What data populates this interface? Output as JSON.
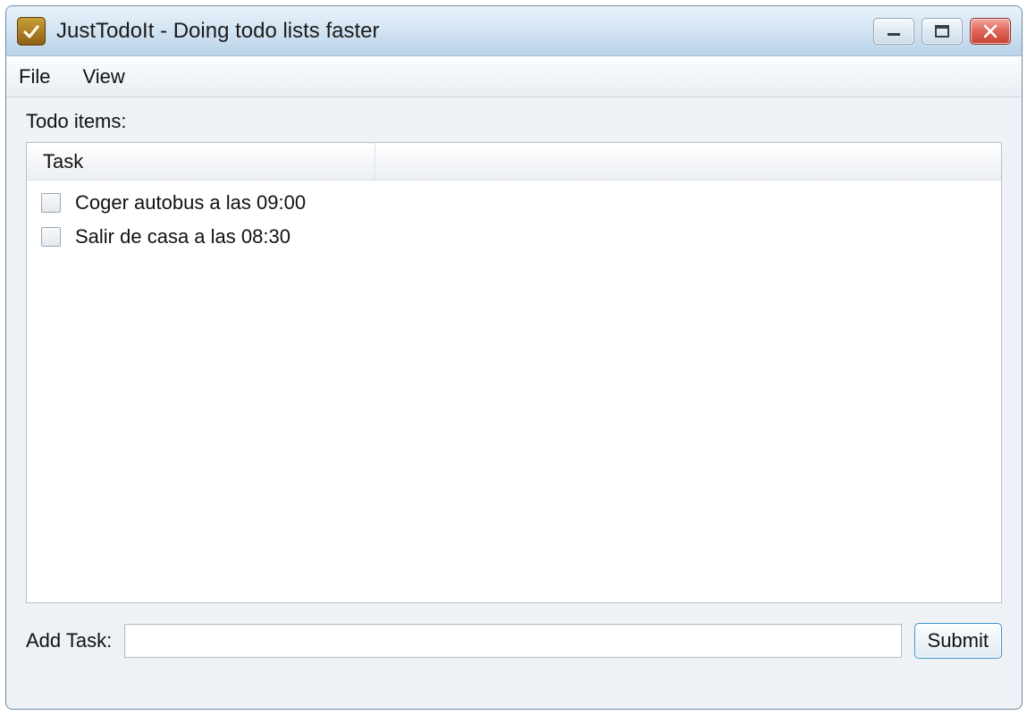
{
  "window": {
    "title": "JustTodoIt - Doing todo lists faster"
  },
  "menubar": {
    "file": "File",
    "view": "View"
  },
  "main": {
    "section_label": "Todo items:",
    "columns": {
      "task": "Task"
    },
    "tasks": [
      {
        "text": "Coger autobus a las 09:00",
        "checked": false
      },
      {
        "text": "Salir de casa a las 08:30",
        "checked": false
      }
    ]
  },
  "addbar": {
    "label": "Add Task:",
    "value": "",
    "submit_label": "Submit"
  }
}
